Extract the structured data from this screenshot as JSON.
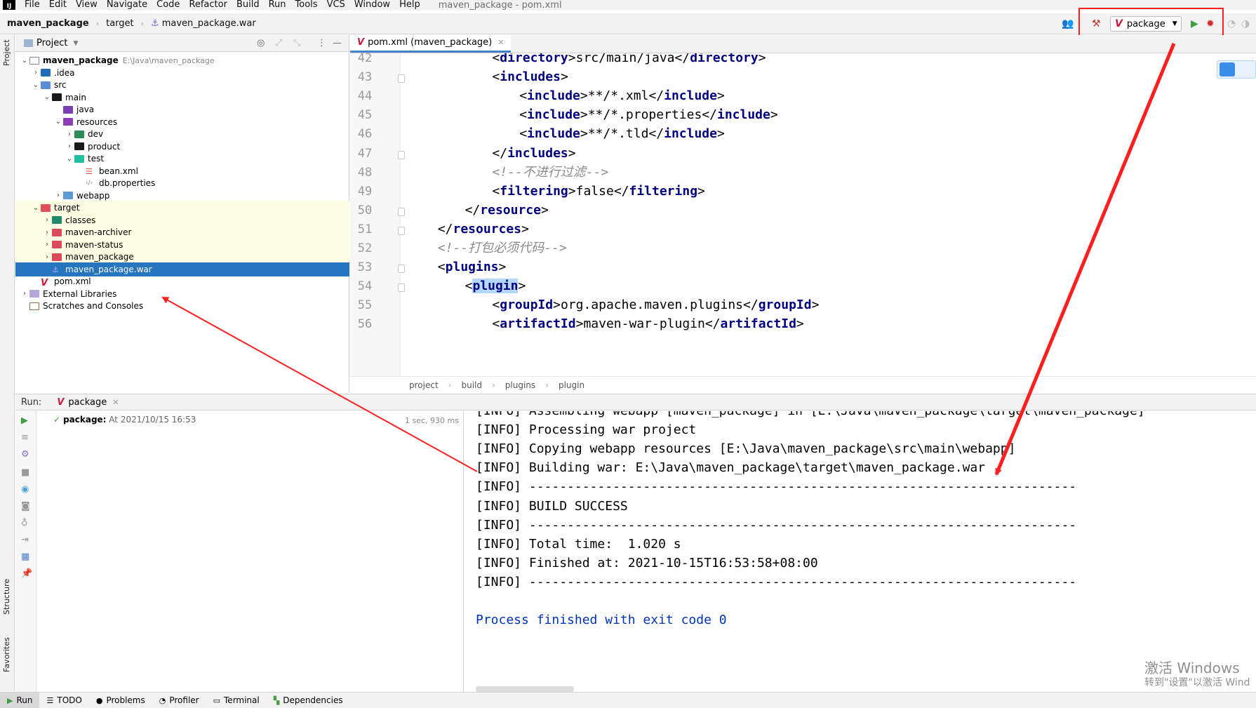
{
  "menubar": {
    "items": [
      "File",
      "Edit",
      "View",
      "Navigate",
      "Code",
      "Refactor",
      "Build",
      "Run",
      "Tools",
      "VCS",
      "Window",
      "Help"
    ],
    "window_title": "maven_package - pom.xml"
  },
  "navbar": {
    "crumbs": [
      "maven_package",
      "target",
      "maven_package.war"
    ]
  },
  "run_config": {
    "label": "package"
  },
  "side_labels": {
    "project": "Project",
    "structure": "Structure",
    "favorites": "Favorites"
  },
  "project_panel": {
    "title": "Project",
    "tree": [
      {
        "label": "maven_package",
        "path": "E:\\Java\\maven_package",
        "depth": 0,
        "expanded": true,
        "icon": "folder-icon"
      },
      {
        "label": ".idea",
        "depth": 1,
        "expanded": false,
        "icon": "folder-icon"
      },
      {
        "label": "src",
        "depth": 1,
        "expanded": true,
        "icon": "folder-icon"
      },
      {
        "label": "main",
        "depth": 2,
        "expanded": true,
        "icon": "folder-icon"
      },
      {
        "label": "java",
        "depth": 3,
        "icon": "folder-icon"
      },
      {
        "label": "resources",
        "depth": 3,
        "expanded": true,
        "icon": "folder-icon"
      },
      {
        "label": "dev",
        "depth": 4,
        "expanded": false,
        "icon": "folder-icon"
      },
      {
        "label": "product",
        "depth": 4,
        "expanded": false,
        "icon": "folder-icon"
      },
      {
        "label": "test",
        "depth": 4,
        "expanded": true,
        "icon": "folder-icon"
      },
      {
        "label": "bean.xml",
        "depth": 5,
        "icon": "xml-file-icon"
      },
      {
        "label": "db.properties",
        "depth": 5,
        "icon": "properties-file-icon"
      },
      {
        "label": "webapp",
        "depth": 3,
        "expanded": false,
        "icon": "folder-icon"
      },
      {
        "label": "target",
        "depth": 1,
        "expanded": true,
        "icon": "folder-icon"
      },
      {
        "label": "classes",
        "depth": 2,
        "expanded": false,
        "icon": "folder-icon"
      },
      {
        "label": "maven-archiver",
        "depth": 2,
        "expanded": false,
        "icon": "folder-icon"
      },
      {
        "label": "maven-status",
        "depth": 2,
        "expanded": false,
        "icon": "folder-icon"
      },
      {
        "label": "maven_package",
        "depth": 2,
        "expanded": false,
        "icon": "folder-icon"
      },
      {
        "label": "maven_package.war",
        "depth": 2,
        "selected": true,
        "icon": "war-file-icon"
      },
      {
        "label": "pom.xml",
        "depth": 1,
        "icon": "maven-icon"
      },
      {
        "label": "External Libraries",
        "depth": 0,
        "expanded": false,
        "icon": "library-icon"
      },
      {
        "label": "Scratches and Consoles",
        "depth": 0,
        "icon": "scratch-icon"
      }
    ]
  },
  "editor": {
    "tab_label": "pom.xml (maven_package)",
    "lines": [
      {
        "num": "42",
        "indent": 6,
        "text": "<directory>src/main/java</directory>"
      },
      {
        "num": "43",
        "indent": 6,
        "text": "<includes>"
      },
      {
        "num": "44",
        "indent": 8,
        "text": "<include>**/*.xml</include>"
      },
      {
        "num": "45",
        "indent": 8,
        "text": "<include>**/*.properties</include>"
      },
      {
        "num": "46",
        "indent": 8,
        "text": "<include>**/*.tld</include>"
      },
      {
        "num": "47",
        "indent": 6,
        "text": "</includes>"
      },
      {
        "num": "48",
        "indent": 6,
        "text": "<!--不进行过滤-->"
      },
      {
        "num": "49",
        "indent": 6,
        "text": "<filtering>false</filtering>"
      },
      {
        "num": "50",
        "indent": 4,
        "text": "</resource>"
      },
      {
        "num": "51",
        "indent": 2,
        "text": "</resources>"
      },
      {
        "num": "52",
        "indent": 2,
        "text": "<!--打包必须代码-->"
      },
      {
        "num": "53",
        "indent": 2,
        "text": "<plugins>"
      },
      {
        "num": "54",
        "indent": 4,
        "text": "<plugin>"
      },
      {
        "num": "55",
        "indent": 6,
        "text": "<groupId>org.apache.maven.plugins</groupId>"
      },
      {
        "num": "56",
        "indent": 6,
        "text": "<artifactId>maven-war-plugin</artifactId>"
      }
    ],
    "breadcrumb": [
      "project",
      "build",
      "plugins",
      "plugin"
    ]
  },
  "run_panel": {
    "header_label": "Run:",
    "tab_label": "package",
    "item_name": "package:",
    "item_time": "At 2021/10/15 16:53",
    "duration": "1 sec, 930 ms",
    "console": [
      "[INFO] Assembling webapp [maven_package] in [E:\\Java\\maven_package\\target\\maven_package]",
      "[INFO] Processing war project",
      "[INFO] Copying webapp resources [E:\\Java\\maven_package\\src\\main\\webapp]",
      "[INFO] Building war: E:\\Java\\maven_package\\target\\maven_package.war",
      "[INFO] ------------------------------------------------------------------------",
      "[INFO] BUILD SUCCESS",
      "[INFO] ------------------------------------------------------------------------",
      "[INFO] Total time:  1.020 s",
      "[INFO] Finished at: 2021-10-15T16:53:58+08:00",
      "[INFO] ------------------------------------------------------------------------",
      "",
      "Process finished with exit code 0"
    ]
  },
  "watermark": {
    "line1": "激活 Windows",
    "line2": "转到\"设置\"以激活 Wind"
  },
  "bottom_tools": [
    "Run",
    "TODO",
    "Problems",
    "Profiler",
    "Terminal",
    "Dependencies"
  ],
  "colors": {
    "accent": "#2675bf",
    "annotation": "#ff1f1f",
    "maven": "#c71a36",
    "xml_tag": "#000080"
  }
}
